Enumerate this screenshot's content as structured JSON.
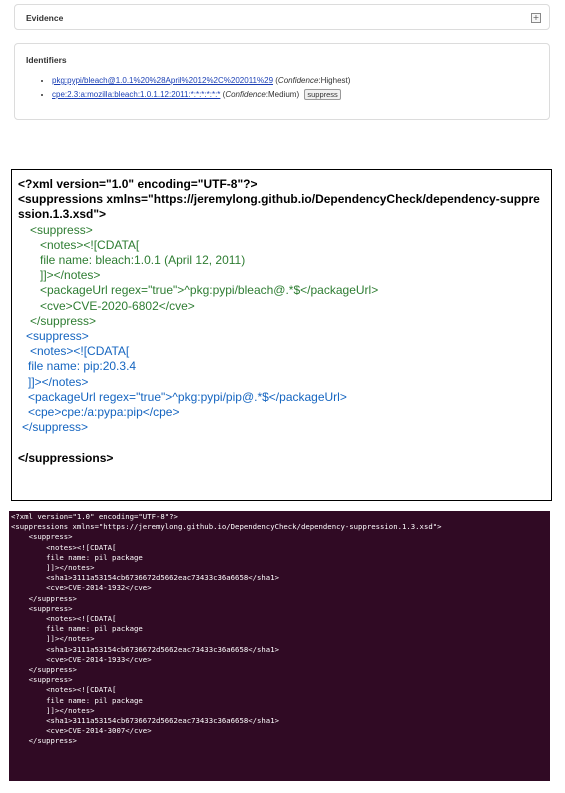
{
  "evidence_panel": {
    "title": "Evidence",
    "toggle": "+"
  },
  "identifiers_panel": {
    "title": "Identifiers",
    "items": [
      {
        "link": "pkg:pypi/bleach@1.0.1%20%28April%2012%2C%202011%29",
        "confidence_label": "Confidence",
        "confidence_value": ":Highest)"
      },
      {
        "link": "cpe:2.3:a:mozilla:bleach:1.0.1.12:2011:*:*:*:*:*:*",
        "confidence_label": "Confidence",
        "confidence_value": ":Medium)",
        "button": "suppress"
      }
    ]
  },
  "xml_box": {
    "lines": [
      {
        "text": "<?xml version=\"1.0\" encoding=\"UTF-8\"?>",
        "style": "b",
        "indent": 0
      },
      {
        "text": "<suppressions xmlns=\"https://jeremylong.github.io/DependencyCheck/dependency-suppression.1.3.xsd\">",
        "style": "b",
        "indent": 0
      },
      {
        "text": "<suppress>",
        "style": "g",
        "indent": 12
      },
      {
        "text": "<notes><![CDATA[",
        "style": "g",
        "indent": 22
      },
      {
        "text": "file name: bleach:1.0.1 (April 12, 2011)",
        "style": "g",
        "indent": 22
      },
      {
        "text": "]]></notes>",
        "style": "g",
        "indent": 22
      },
      {
        "text": "<packageUrl regex=\"true\">^pkg:pypi/bleach@.*$</packageUrl>",
        "style": "g",
        "indent": 22
      },
      {
        "text": "<cve>CVE-2020-6802</cve>",
        "style": "g",
        "indent": 22
      },
      {
        "text": "</suppress>",
        "style": "g",
        "indent": 12
      },
      {
        "text": "<suppress>",
        "style": "bl",
        "indent": 8
      },
      {
        "text": "<notes><![CDATA[",
        "style": "bl",
        "indent": 12
      },
      {
        "text": "file name: pip:20.3.4",
        "style": "bl",
        "indent": 10
      },
      {
        "text": "]]></notes>",
        "style": "bl",
        "indent": 10
      },
      {
        "text": "<packageUrl regex=\"true\">^pkg:pypi/pip@.*$</packageUrl>",
        "style": "bl",
        "indent": 10
      },
      {
        "text": "<cpe>cpe:/a:pypa:pip</cpe>",
        "style": "bl",
        "indent": 10
      },
      {
        "text": "</suppress>",
        "style": "bl",
        "indent": 4
      },
      {
        "text": "",
        "style": "b",
        "indent": 0
      },
      {
        "text": "</suppressions>",
        "style": "b",
        "indent": 0
      }
    ]
  },
  "terminal": {
    "lines": [
      "<?xml version=\"1.0\" encoding=\"UTF-8\"?>",
      "<suppressions xmlns=\"https://jeremylong.github.io/DependencyCheck/dependency-suppression.1.3.xsd\">",
      "    <suppress>",
      "        <notes><![CDATA[",
      "        file name: pil package",
      "        ]]></notes>",
      "        <sha1>3111a53154cb6736672d5662eac73433c36a6658</sha1>",
      "        <cve>CVE-2014-1932</cve>",
      "    </suppress>",
      "    <suppress>",
      "        <notes><![CDATA[",
      "        file name: pil package",
      "        ]]></notes>",
      "        <sha1>3111a53154cb6736672d5662eac73433c36a6658</sha1>",
      "        <cve>CVE-2014-1933</cve>",
      "    </suppress>",
      "    <suppress>",
      "        <notes><![CDATA[",
      "        file name: pil package",
      "        ]]></notes>",
      "        <sha1>3111a53154cb6736672d5662eac73433c36a6658</sha1>",
      "        <cve>CVE-2014-3007</cve>",
      "    </suppress>"
    ]
  },
  "colors": {
    "terminal_bg": "#300a24",
    "xml_green": "#2e7d32",
    "xml_blue": "#1565c0",
    "link": "#1a3fb5"
  }
}
